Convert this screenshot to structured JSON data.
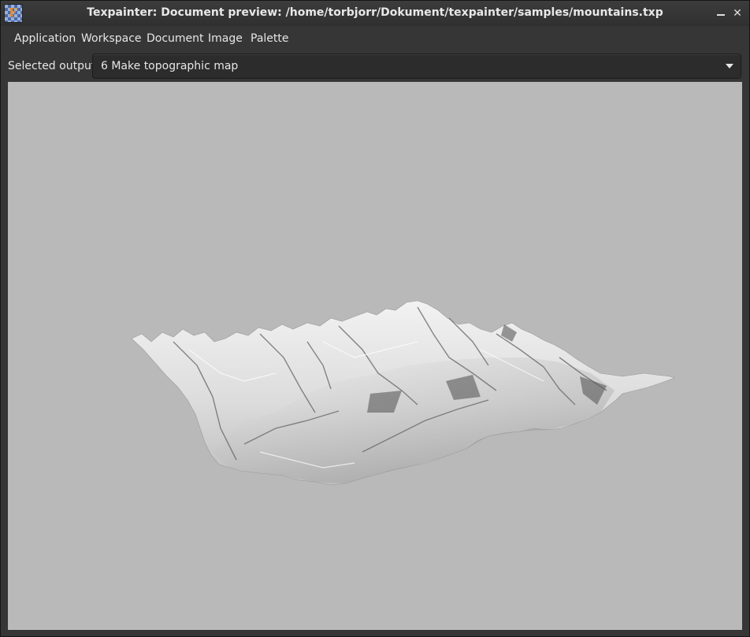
{
  "window": {
    "title": "Texpainter: Document preview: /home/torbjorr/Dokument/texpainter/samples/mountains.txp",
    "app_icon_glyph": "F",
    "minimize_icon": "minimize-icon",
    "close_icon": "close-icon",
    "close_glyph": "✕"
  },
  "menubar": {
    "items": [
      {
        "label": "Application"
      },
      {
        "label": "Workspace"
      },
      {
        "label": "Document"
      },
      {
        "label": "Image"
      },
      {
        "label": "Palette"
      }
    ]
  },
  "toolbar": {
    "output_label": "Selected output:",
    "output_value": "6 Make topographic map"
  },
  "preview": {
    "background": "#b9b9b9",
    "content": "3D rendered snowy mountain terrain"
  },
  "colors": {
    "window_bg": "#363636",
    "titlebar_text": "#e8e8e8",
    "viewport_bg": "#b9b9b9"
  }
}
